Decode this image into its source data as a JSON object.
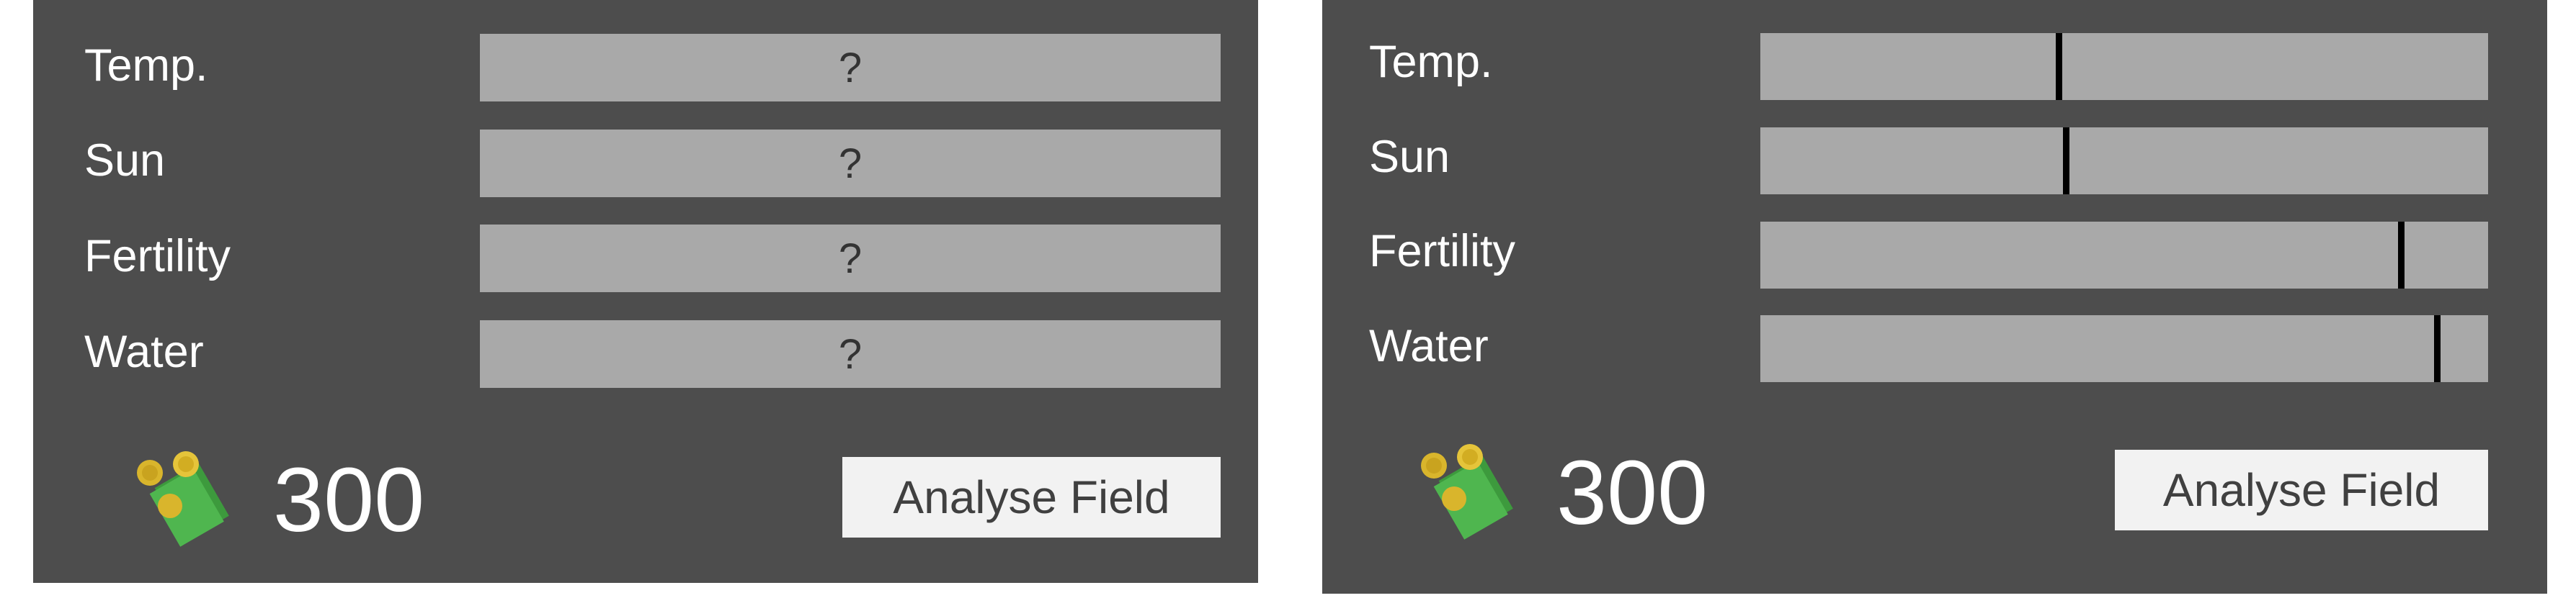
{
  "left_panel": {
    "rows": [
      {
        "label": "Temp.",
        "value": "?"
      },
      {
        "label": "Sun",
        "value": "?"
      },
      {
        "label": "Fertility",
        "value": "?"
      },
      {
        "label": "Water",
        "value": "?"
      }
    ],
    "money": "300",
    "money_icon": "money-stack-with-coins",
    "button_label": "Analyse Field"
  },
  "right_panel": {
    "rows": [
      {
        "label": "Temp.",
        "level": 0.41
      },
      {
        "label": "Sun",
        "level": 0.42
      },
      {
        "label": "Fertility",
        "level": 0.88
      },
      {
        "label": "Water",
        "level": 0.93
      }
    ],
    "money": "300",
    "money_icon": "money-stack-with-coins",
    "button_label": "Analyse Field"
  },
  "colors": {
    "panel_bg": "#4d4d4d",
    "bar_bg": "#a9a9a9",
    "marker": "#000000",
    "button_bg": "#f2f2f2",
    "text": "#ffffff"
  }
}
